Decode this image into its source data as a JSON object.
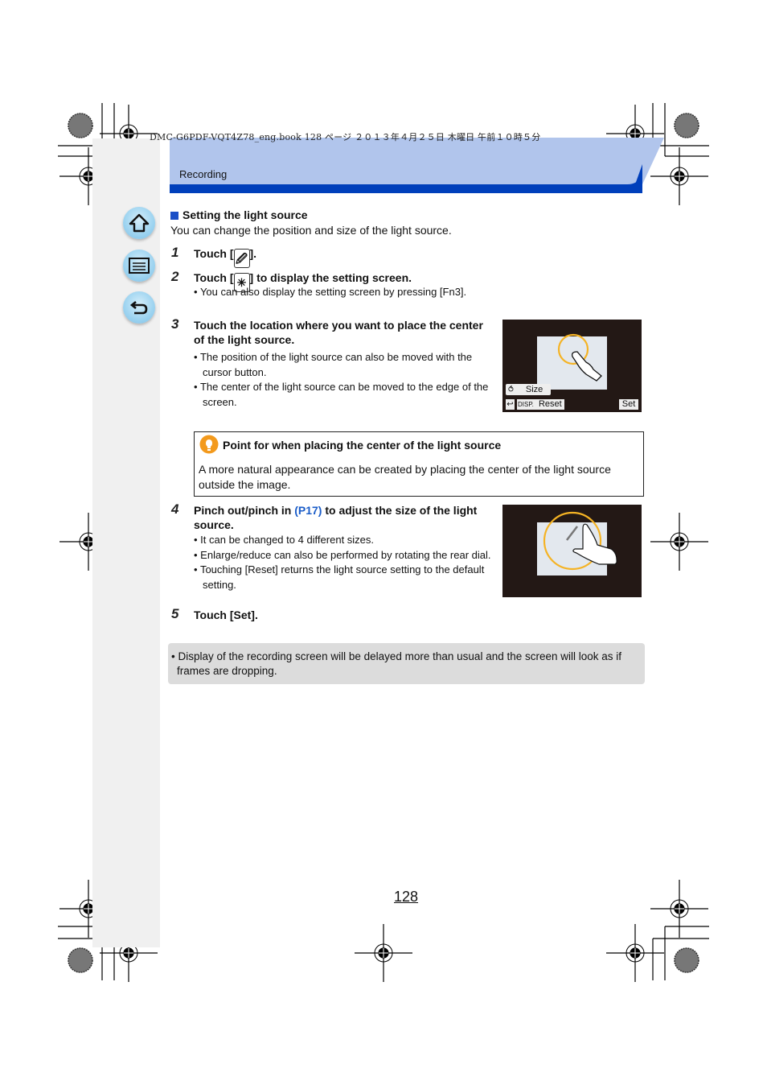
{
  "book_line": "DMC-G6PDF-VQT4Z78_eng.book  128 ページ  ２０１３年４月２５日  木曜日  午前１０時５分",
  "header": {
    "section": "Recording"
  },
  "nav": [
    {
      "name": "home",
      "icon": "home-icon"
    },
    {
      "name": "contents",
      "icon": "list-icon"
    },
    {
      "name": "back",
      "icon": "return-icon"
    }
  ],
  "section": {
    "title": "Setting the light source",
    "intro": "You can change the position and size of the light source."
  },
  "steps": [
    {
      "num": "1",
      "pre": "Touch [",
      "post": "].",
      "icon": "light-source-icon",
      "bullets": []
    },
    {
      "num": "2",
      "pre": "Touch [",
      "post": "] to display the setting screen.",
      "icon": "light-setting-icon",
      "bullets": [
        "You can also display the setting screen by pressing [Fn3]."
      ]
    },
    {
      "num": "3",
      "text": "Touch the location where you want to place the center of the light source.",
      "bullets": [
        "The position of the light source can also be moved with the cursor button.",
        "The center of the light source can be moved to the edge of the screen."
      ]
    },
    {
      "num": "4",
      "pre": "Pinch out/pinch in ",
      "link": "(P17)",
      "post": " to adjust the size of the light source.",
      "bullets": [
        "It can be changed to 4 different sizes.",
        "Enlarge/reduce can also be performed by rotating the rear dial.",
        "Touching [Reset] returns the light source setting to the default setting."
      ]
    },
    {
      "num": "5",
      "text": "Touch [Set].",
      "bullets": []
    }
  ],
  "screen1": {
    "size_label": "Size",
    "disp_label": "DISP.",
    "reset_label": "Reset",
    "set_label": "Set"
  },
  "tip": {
    "title": "Point for when placing the center of the light source",
    "body": "A more natural appearance can be created by placing the center of the light source outside the image."
  },
  "note": "Display of the recording screen will be delayed more than usual and the screen will look as if frames are dropping.",
  "page_number": "128",
  "colors": {
    "accent": "#003fbb",
    "band": "#b1c5ec",
    "link": "#1a5cc8",
    "highlight_ring": "#f5b324"
  }
}
